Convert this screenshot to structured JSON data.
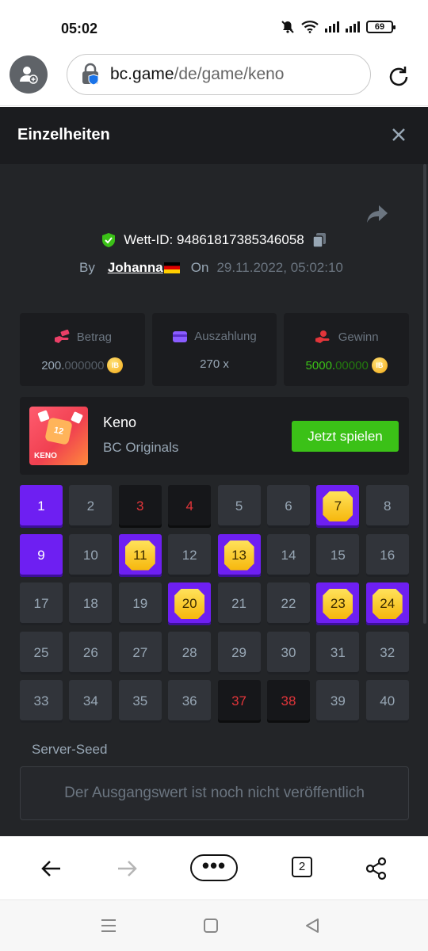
{
  "status_bar": {
    "time": "05:02",
    "battery": "69"
  },
  "browser": {
    "url_domain": "bc.game",
    "url_path": "/de/game/keno",
    "tab_count": "2",
    "menu_label": "•••"
  },
  "details": {
    "title": "Einzelheiten",
    "bet_id_label": "Wett-ID: 94861817385346058",
    "by_label": "By",
    "username": "Johanna",
    "on_label": "On",
    "date": "29.11.2022, 05:02:10"
  },
  "stats": {
    "betrag": {
      "label": "Betrag",
      "value_main": "200.",
      "value_dim": "000000",
      "coin": "IB"
    },
    "auszahlung": {
      "label": "Auszahlung",
      "value": "270 x"
    },
    "gewinn": {
      "label": "Gewinn",
      "value_main": "5000.",
      "value_dim": "00000",
      "coin": "IB"
    }
  },
  "game": {
    "thumb_label": "KENO",
    "thumb_number": "12",
    "name": "Keno",
    "provider": "BC Originals",
    "play_button": "Jetzt spielen"
  },
  "keno_grid": [
    {
      "n": "1",
      "state": "pick"
    },
    {
      "n": "2",
      "state": "idle"
    },
    {
      "n": "3",
      "state": "miss"
    },
    {
      "n": "4",
      "state": "miss"
    },
    {
      "n": "5",
      "state": "idle"
    },
    {
      "n": "6",
      "state": "idle"
    },
    {
      "n": "7",
      "state": "hit"
    },
    {
      "n": "8",
      "state": "idle"
    },
    {
      "n": "9",
      "state": "pick"
    },
    {
      "n": "10",
      "state": "idle"
    },
    {
      "n": "11",
      "state": "hit"
    },
    {
      "n": "12",
      "state": "idle"
    },
    {
      "n": "13",
      "state": "hit"
    },
    {
      "n": "14",
      "state": "idle"
    },
    {
      "n": "15",
      "state": "idle"
    },
    {
      "n": "16",
      "state": "idle"
    },
    {
      "n": "17",
      "state": "idle"
    },
    {
      "n": "18",
      "state": "idle"
    },
    {
      "n": "19",
      "state": "idle"
    },
    {
      "n": "20",
      "state": "hit"
    },
    {
      "n": "21",
      "state": "idle"
    },
    {
      "n": "22",
      "state": "idle"
    },
    {
      "n": "23",
      "state": "hit"
    },
    {
      "n": "24",
      "state": "hit"
    },
    {
      "n": "25",
      "state": "idle"
    },
    {
      "n": "26",
      "state": "idle"
    },
    {
      "n": "27",
      "state": "idle"
    },
    {
      "n": "28",
      "state": "idle"
    },
    {
      "n": "29",
      "state": "idle"
    },
    {
      "n": "30",
      "state": "idle"
    },
    {
      "n": "31",
      "state": "idle"
    },
    {
      "n": "32",
      "state": "idle"
    },
    {
      "n": "33",
      "state": "idle"
    },
    {
      "n": "34",
      "state": "idle"
    },
    {
      "n": "35",
      "state": "idle"
    },
    {
      "n": "36",
      "state": "idle"
    },
    {
      "n": "37",
      "state": "miss"
    },
    {
      "n": "38",
      "state": "miss"
    },
    {
      "n": "39",
      "state": "idle"
    },
    {
      "n": "40",
      "state": "idle"
    }
  ],
  "server_seed": {
    "label": "Server-Seed",
    "placeholder": "Der Ausgangswert ist noch nicht veröffentlich"
  },
  "colors": {
    "accent_purple": "#6e1ff2",
    "accent_green": "#3bc117",
    "miss_red": "#e2353a",
    "panel_bg": "#232528"
  }
}
